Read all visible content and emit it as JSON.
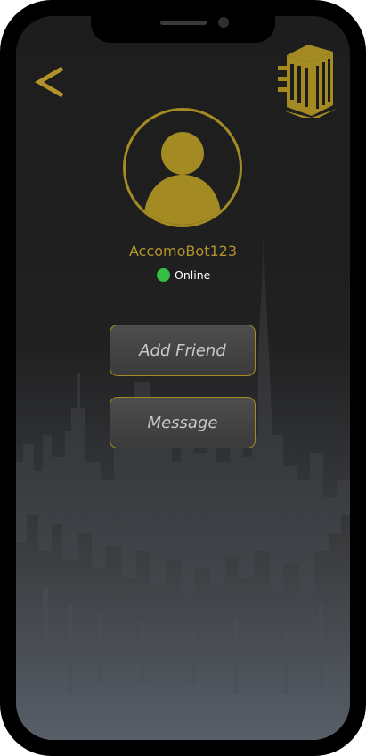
{
  "profile": {
    "username": "AccomoBot123",
    "status_text": "Online",
    "status_color": "#35c043"
  },
  "actions": {
    "add_friend_label": "Add Friend",
    "message_label": "Message"
  },
  "icons": {
    "back": "back-chevron-icon",
    "logo": "building-icon",
    "avatar": "user-silhouette-icon"
  },
  "theme": {
    "accent_gold": "#a48a22",
    "background_dark": "#1d1d1d"
  }
}
